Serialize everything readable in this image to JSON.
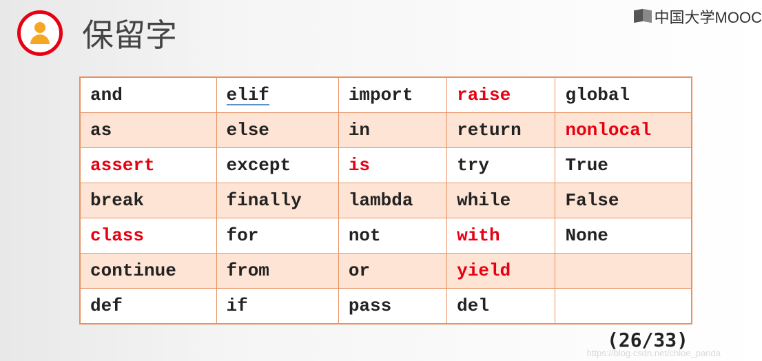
{
  "brand": "中国大学MOOC",
  "title": "保留字",
  "counter": "(26/33)",
  "watermark": "https://blog.csdn.net/chloe_panda",
  "table": [
    [
      {
        "t": "and"
      },
      {
        "t": "elif",
        "u": true
      },
      {
        "t": "import"
      },
      {
        "t": "raise",
        "red": true
      },
      {
        "t": "global"
      }
    ],
    [
      {
        "t": "as"
      },
      {
        "t": "else"
      },
      {
        "t": "in"
      },
      {
        "t": "return"
      },
      {
        "t": "nonlocal",
        "red": true
      }
    ],
    [
      {
        "t": "assert",
        "red": true
      },
      {
        "t": "except"
      },
      {
        "t": "is",
        "red": true
      },
      {
        "t": "try"
      },
      {
        "t": "True"
      }
    ],
    [
      {
        "t": "break"
      },
      {
        "t": "finally"
      },
      {
        "t": "lambda"
      },
      {
        "t": "while"
      },
      {
        "t": "False"
      }
    ],
    [
      {
        "t": "class",
        "red": true
      },
      {
        "t": "for"
      },
      {
        "t": "not"
      },
      {
        "t": "with",
        "red": true
      },
      {
        "t": "None"
      }
    ],
    [
      {
        "t": "continue"
      },
      {
        "t": "from"
      },
      {
        "t": "or"
      },
      {
        "t": "yield",
        "red": true
      },
      {
        "t": ""
      }
    ],
    [
      {
        "t": "def"
      },
      {
        "t": "if"
      },
      {
        "t": "pass"
      },
      {
        "t": "del"
      },
      {
        "t": ""
      }
    ]
  ]
}
